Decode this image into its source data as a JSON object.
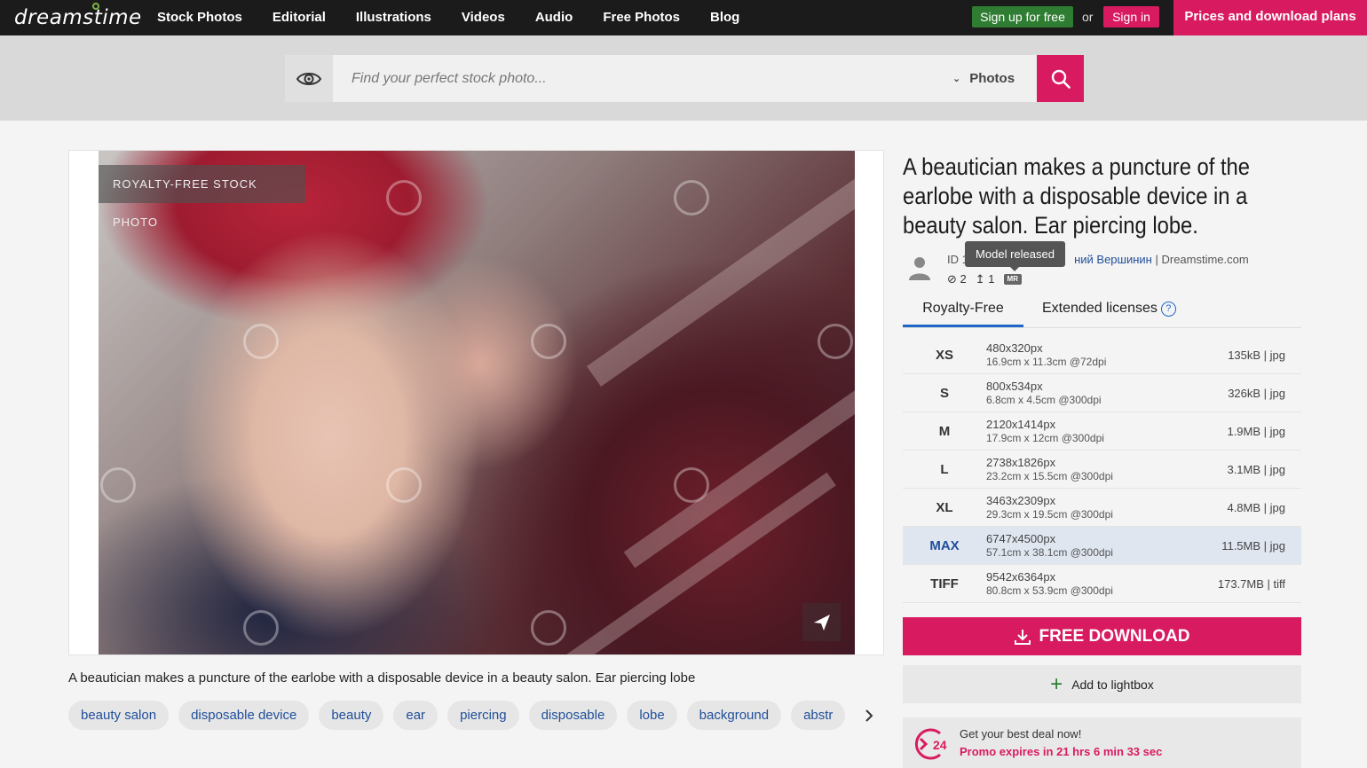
{
  "header": {
    "logo": "dreamstime",
    "nav": [
      "Stock Photos",
      "Editorial",
      "Illustrations",
      "Videos",
      "Audio",
      "Free Photos",
      "Blog"
    ],
    "signup": "Sign up for free",
    "or": "or",
    "signin": "Sign in",
    "plans": "Prices and download plans"
  },
  "search": {
    "placeholder": "Find your perfect stock photo...",
    "type": "Photos"
  },
  "image": {
    "badge": "ROYALTY-FREE STOCK PHOTO",
    "caption": "A beautician makes a puncture of the earlobe with a disposable device in a beauty salon. Ear piercing lobe",
    "tags": [
      "beauty salon",
      "disposable device",
      "beauty",
      "ear",
      "piercing",
      "disposable",
      "lobe",
      "background",
      "abstr"
    ]
  },
  "details": {
    "title": "A beautician makes a puncture of the earlobe with a disposable device in a beauty salon. Ear piercing lobe.",
    "id_prefix": "ID 1",
    "author": "ний Вершинин",
    "site": "| Dreamstime.com",
    "views": "2",
    "downloads": "1",
    "mr": "MR",
    "tooltip": "Model released"
  },
  "licenses": {
    "tabs": [
      "Royalty-Free",
      "Extended licenses"
    ],
    "help": "?",
    "sizes": [
      {
        "code": "XS",
        "px": "480x320px",
        "cm": "16.9cm x 11.3cm @72dpi",
        "file": "135kB | jpg"
      },
      {
        "code": "S",
        "px": "800x534px",
        "cm": "6.8cm x 4.5cm @300dpi",
        "file": "326kB | jpg"
      },
      {
        "code": "M",
        "px": "2120x1414px",
        "cm": "17.9cm x 12cm @300dpi",
        "file": "1.9MB | jpg"
      },
      {
        "code": "L",
        "px": "2738x1826px",
        "cm": "23.2cm x 15.5cm @300dpi",
        "file": "3.1MB | jpg"
      },
      {
        "code": "XL",
        "px": "3463x2309px",
        "cm": "29.3cm x 19.5cm @300dpi",
        "file": "4.8MB | jpg"
      },
      {
        "code": "MAX",
        "px": "6747x4500px",
        "cm": "57.1cm x 38.1cm @300dpi",
        "file": "11.5MB | jpg"
      },
      {
        "code": "TIFF",
        "px": "9542x6364px",
        "cm": "80.8cm x 53.9cm @300dpi",
        "file": "173.7MB | tiff"
      }
    ],
    "selected": "MAX"
  },
  "actions": {
    "free_download": "FREE DOWNLOAD",
    "lightbox": "Add to lightbox"
  },
  "promo": {
    "line1": "Get your best deal now!",
    "line2": "Promo expires in 21 hrs 6 min 33 sec",
    "icon_text": "24"
  },
  "colors": {
    "brand": "#d81b60",
    "signup": "#2e7d32",
    "link": "#1f4e99",
    "tab_active": "#1f66c7"
  }
}
